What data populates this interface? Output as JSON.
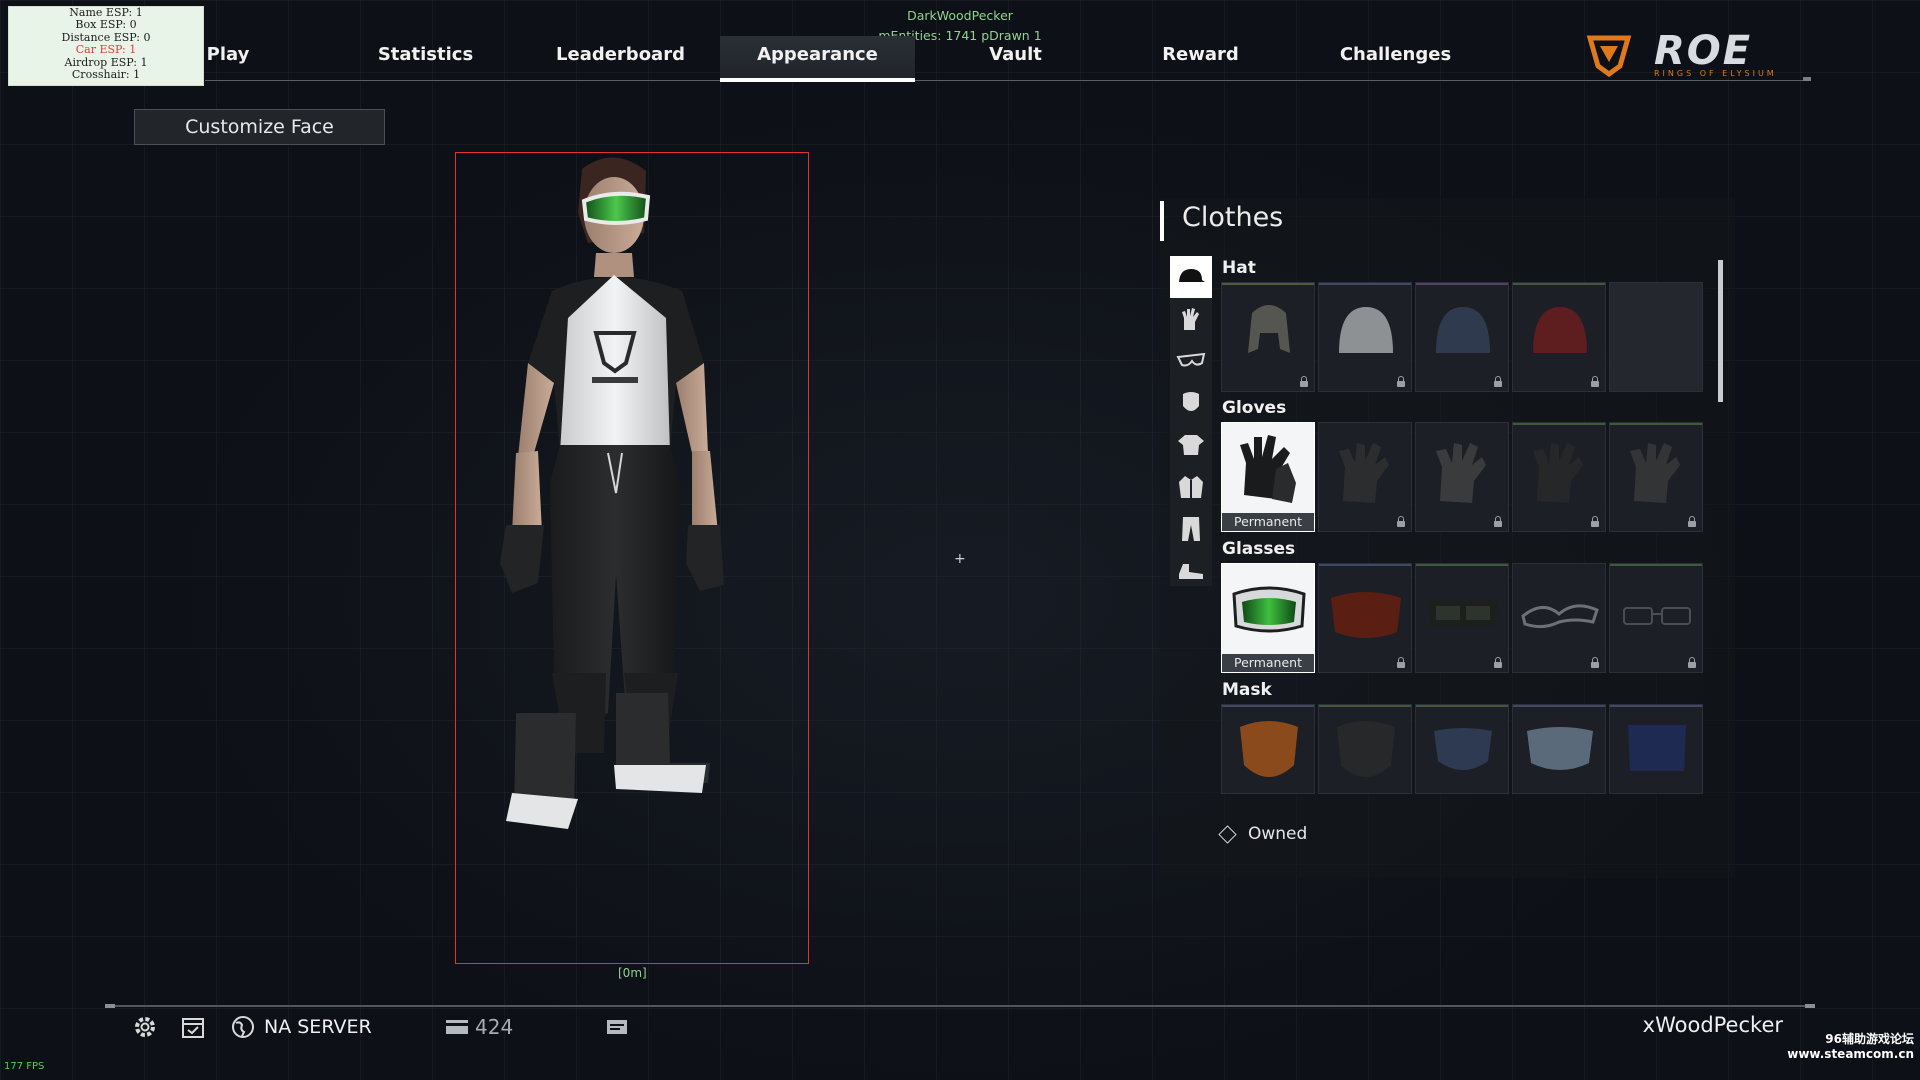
{
  "debug_overlay": {
    "lines": [
      "Name ESP: 1",
      "Box ESP: 0",
      "Distance ESP: 0",
      "Car ESP: 1",
      "Airdrop ESP: 1",
      "Crosshair: 1"
    ],
    "highlight_line_color": "#e23a3a",
    "top_player": "DarkWoodPecker",
    "top_stats": "mEntities: 1741 pDrawn 1",
    "char_distance": "[0m]",
    "fps": "177 FPS"
  },
  "nav": {
    "tabs": [
      "Play",
      "Statistics",
      "Leaderboard",
      "Appearance",
      "Vault",
      "Reward",
      "Challenges"
    ],
    "active_tab": "Appearance"
  },
  "logo": {
    "text": "ROE",
    "sub": "RINGS OF ELYSIUM",
    "accent": "#e0791b"
  },
  "customize_face": {
    "label": "Customize Face"
  },
  "clothes": {
    "title": "Clothes",
    "categories": [
      "hat-icon",
      "gloves-icon",
      "glasses-icon",
      "mask-icon",
      "shirt-icon",
      "jacket-icon",
      "pants-icon",
      "shoes-icon"
    ],
    "active_category": "hat-icon",
    "sections": [
      {
        "name": "Hat",
        "items": [
          {
            "label": "",
            "locked": true,
            "rarity_color": "#4f5a3e"
          },
          {
            "label": "",
            "locked": true,
            "rarity_color": "#3b4a66"
          },
          {
            "label": "",
            "locked": true,
            "rarity_color": "#5a3e6a"
          },
          {
            "label": "",
            "locked": true,
            "rarity_color": "#3f5a3a"
          },
          {
            "label": "",
            "locked": false,
            "rarity_color": "#2b3038"
          }
        ]
      },
      {
        "name": "Gloves",
        "items": [
          {
            "label": "Permanent",
            "locked": false,
            "selected": true
          },
          {
            "label": "",
            "locked": true,
            "rarity_color": "#2f3a2a"
          },
          {
            "label": "",
            "locked": true,
            "rarity_color": "#2f3a2a"
          },
          {
            "label": "",
            "locked": true,
            "rarity_color": "#3f5a3a"
          },
          {
            "label": "",
            "locked": true,
            "rarity_color": "#3f5a3a"
          }
        ]
      },
      {
        "name": "Glasses",
        "items": [
          {
            "label": "Permanent",
            "locked": false,
            "selected": true
          },
          {
            "label": "",
            "locked": true,
            "rarity_color": "#3b4a66"
          },
          {
            "label": "",
            "locked": true,
            "rarity_color": "#3f5a3a"
          },
          {
            "label": "",
            "locked": true,
            "rarity_color": "#2f3a2a"
          },
          {
            "label": "",
            "locked": true,
            "rarity_color": "#3f5a3a"
          }
        ]
      },
      {
        "name": "Mask",
        "items": [
          {
            "label": "",
            "locked": false,
            "rarity_color": "#3b4a66"
          },
          {
            "label": "",
            "locked": false,
            "rarity_color": "#3f5a3a"
          },
          {
            "label": "",
            "locked": false,
            "rarity_color": "#3f5a3a"
          },
          {
            "label": "",
            "locked": false,
            "rarity_color": "#3b4a66"
          },
          {
            "label": "",
            "locked": false,
            "rarity_color": "#3b4a66"
          }
        ]
      }
    ],
    "owned_label": "Owned"
  },
  "bottom_bar": {
    "server": "NA SERVER",
    "currency": "424",
    "username": "xWoodPecker"
  },
  "watermark": {
    "line1": "96辅助游戏论坛",
    "line2": "www.steamcom.cn"
  }
}
